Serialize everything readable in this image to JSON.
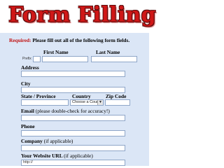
{
  "title": "Form Filling",
  "required_prefix": "Required:",
  "required_text": "Please fill out all of the following form fields.",
  "name": {
    "first_label": "First Name",
    "last_label": "Last Name",
    "prefix_label": "Prefix"
  },
  "address": {
    "label": "Address"
  },
  "city": {
    "label": "City"
  },
  "state": {
    "label": "State / Province"
  },
  "country": {
    "label": "Country",
    "value": "Choose a Country"
  },
  "zip": {
    "label": "Zip Code"
  },
  "email": {
    "label": "Email",
    "hint": "(please double-check for accuracy!)"
  },
  "phone": {
    "label": "Phone"
  },
  "company": {
    "label": "Company",
    "hint": "(if applicable)"
  },
  "website": {
    "label": "Your Website URL",
    "hint": "(if applicable)",
    "value": "http://"
  },
  "colors": {
    "title_red": "#d01717",
    "form_bg": "#dbe6f6",
    "required_red": "#c01010"
  }
}
